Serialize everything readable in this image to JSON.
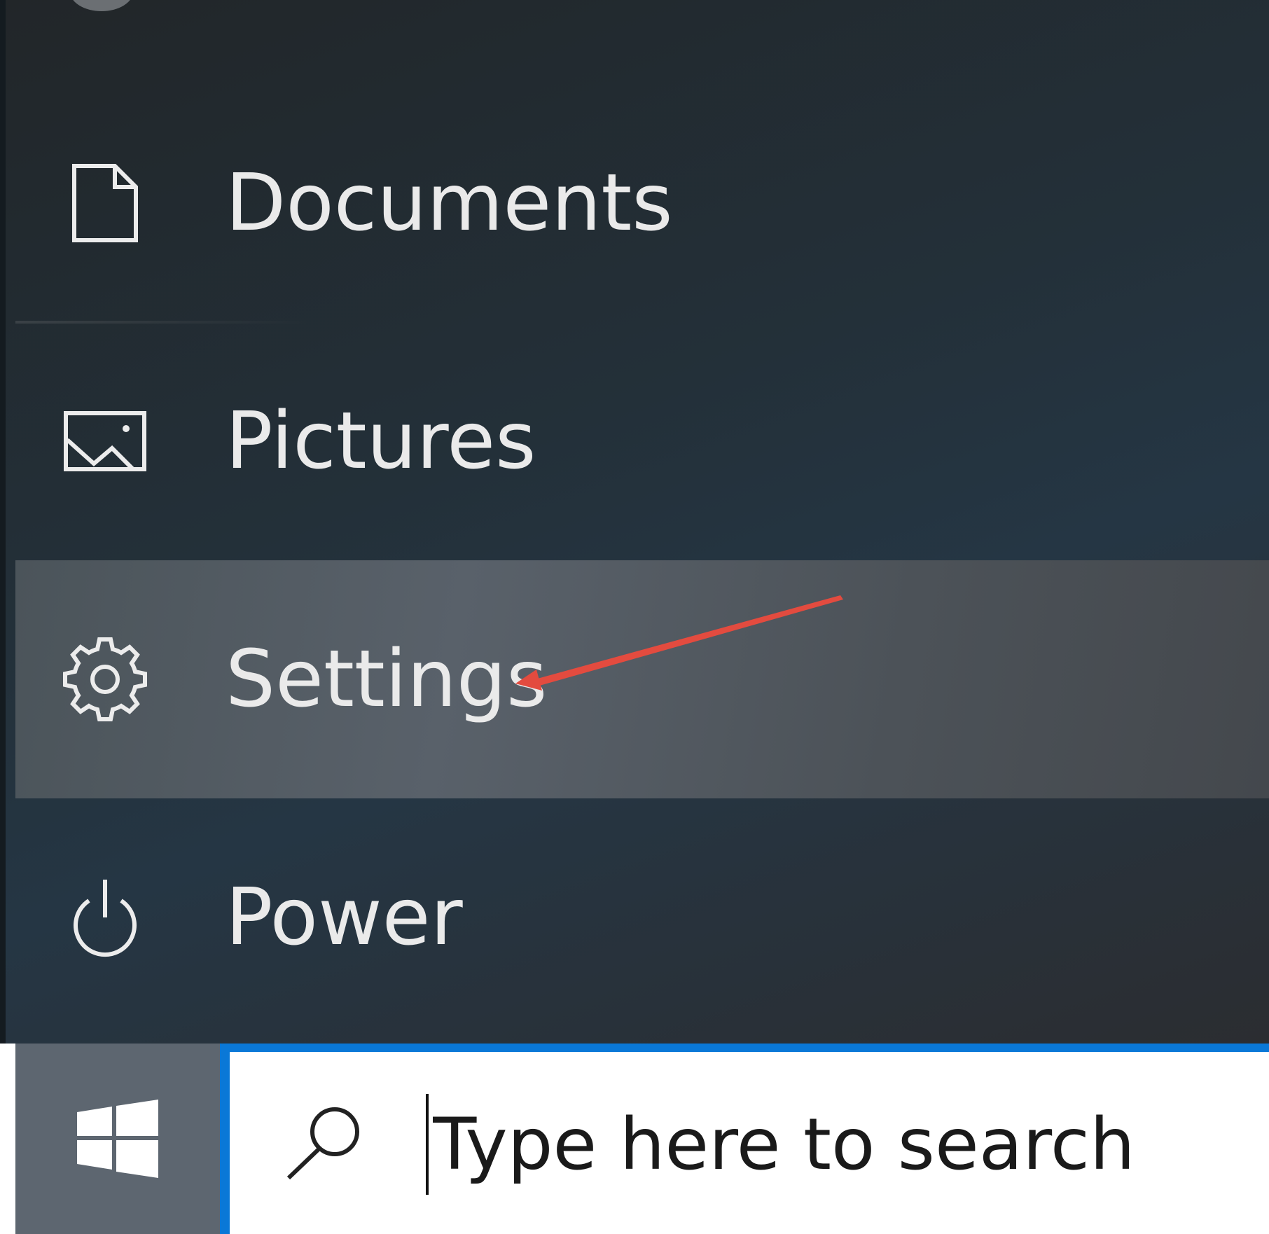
{
  "menu": {
    "items": [
      {
        "label": "Documents",
        "icon": "document-icon"
      },
      {
        "label": "Pictures",
        "icon": "pictures-icon"
      },
      {
        "label": "Settings",
        "icon": "gear-icon",
        "highlighted": true
      },
      {
        "label": "Power",
        "icon": "power-icon"
      }
    ]
  },
  "taskbar": {
    "start_icon": "windows-logo-icon",
    "search": {
      "placeholder": "Type here to search",
      "icon": "search-icon"
    }
  },
  "colors": {
    "accent": "#0a78d7",
    "annotation_arrow": "#e34b3f",
    "highlight": "#59616a"
  }
}
